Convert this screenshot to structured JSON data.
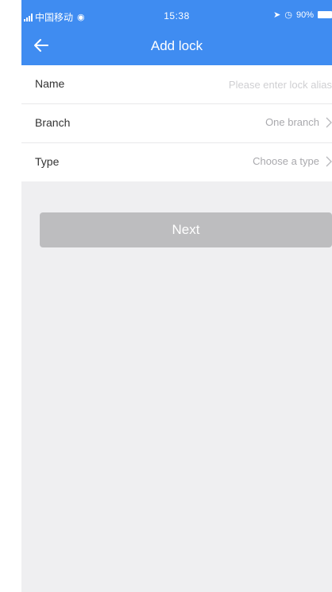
{
  "status_bar": {
    "carrier": "中国移动",
    "time": "15:38",
    "battery": "90%"
  },
  "nav": {
    "back_icon": "arrow-left-icon",
    "title": "Add lock"
  },
  "form": {
    "rows": [
      {
        "label": "Name",
        "placeholder": "Please enter lock alias"
      },
      {
        "label": "Branch",
        "value": "One branch"
      },
      {
        "label": "Type",
        "value": "Choose a type"
      }
    ]
  },
  "actions": {
    "next_label": "Next"
  },
  "colors": {
    "header": "#3f8cf1",
    "background": "#efeff1",
    "button_disabled": "#bdbdbf"
  }
}
